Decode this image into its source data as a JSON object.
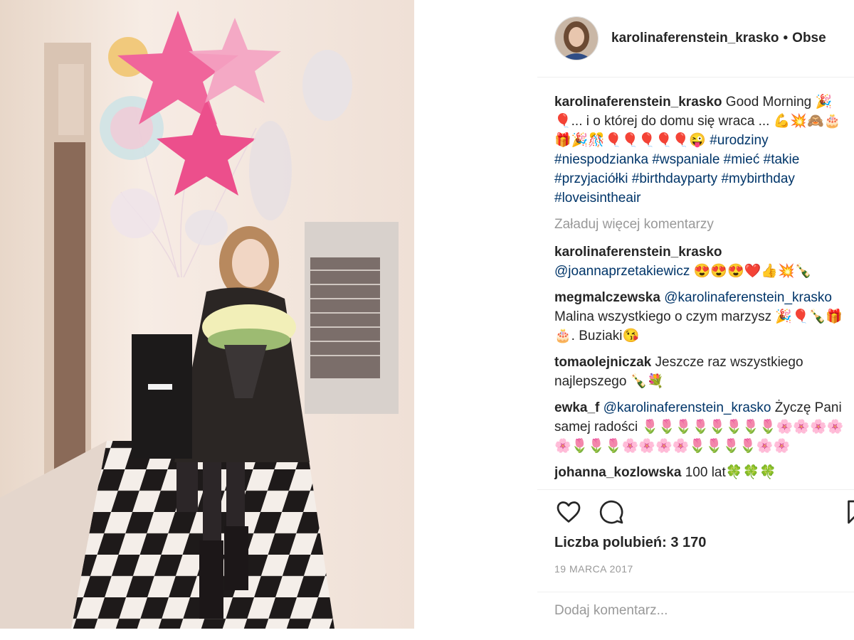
{
  "post": {
    "username": "karolinaferenstein_krasko",
    "separator": "•",
    "follow_label": "Obse",
    "caption": {
      "text_1": "Good Morning 🎉🎈... i o której do domu się wraca ... 💪💥🙈🎂🎁🎉🎊🎈🎈🎈🎈🎈😜 ",
      "tags": "#urodziny #niespodzianka #wspaniale #mieć #takie #przyjaciółki #birthdayparty #mybirthday #loveisintheair"
    },
    "load_more": "Załaduj więcej komentarzy",
    "comments": [
      {
        "user": "karolinaferenstein_krasko",
        "mention": "@joannaprzetakiewicz",
        "text": " 😍😍😍❤️👍💥🍾"
      },
      {
        "user": "megmalczewska",
        "mention": "@karolinaferenstein_krasko",
        "text": " Malina wszystkiego o czym marzysz 🎉🎈🍾🎁🎂. Buziaki😘"
      },
      {
        "user": "tomaolejniczak",
        "mention": "",
        "text": "Jeszcze raz wszystkiego najlepszego 🍾💐"
      },
      {
        "user": "ewka_f",
        "mention": "@karolinaferenstein_krasko",
        "text": " Życzę Pani samej radości 🌷🌷🌷🌷🌷🌷🌷🌷🌸🌸🌸🌸🌸🌷🌷🌷🌸🌸🌸🌸🌷🌷🌷🌷🌸🌸"
      },
      {
        "user": "johanna_kozlowska",
        "mention": "",
        "text": "100 lat🍀🍀🍀"
      }
    ],
    "likes_text": "Liczba polubień: 3 170",
    "date": "19 MARCA 2017",
    "add_comment_placeholder": "Dodaj komentarz..."
  },
  "icons": {
    "like": "heart-icon",
    "comment": "comment-icon",
    "save": "bookmark-icon"
  },
  "colors": {
    "text": "#262626",
    "hashtag": "#003569",
    "muted": "#999999",
    "divider": "#efefef"
  }
}
